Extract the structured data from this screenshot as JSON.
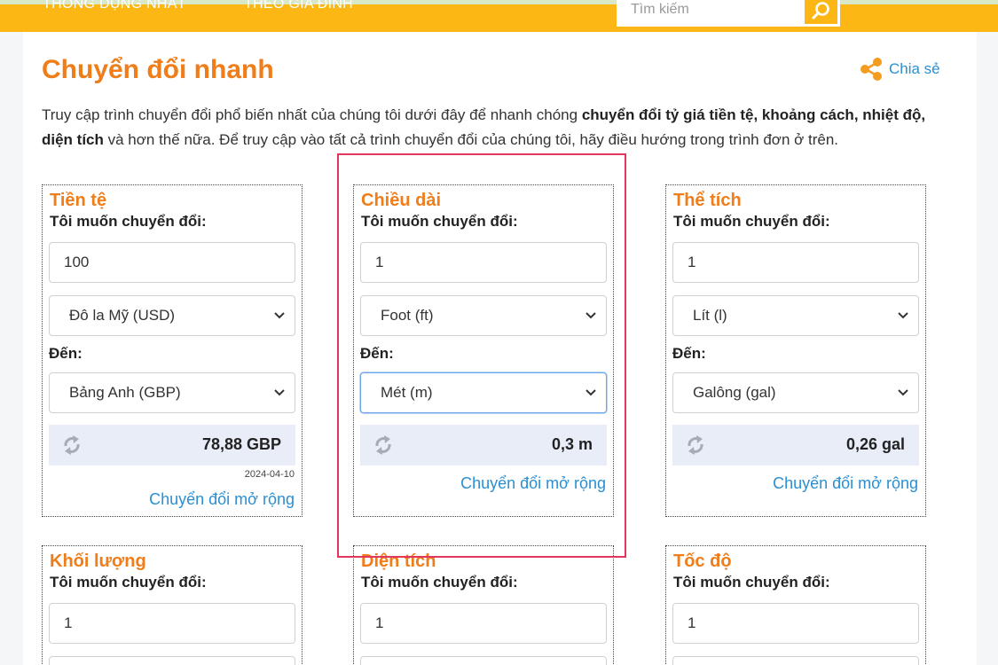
{
  "nav": {
    "items": [
      "THÔNG DỤNG NHẤT",
      "THEO GIA ĐÌNH"
    ],
    "search_placeholder": "Tìm kiếm",
    "search_icon": "search-icon"
  },
  "page": {
    "title": "Chuyển đổi nhanh",
    "share_label": "Chia sẻ",
    "intro_1": "Truy cập trình chuyển đổi phổ biến nhất của chúng tôi dưới đây để nhanh chóng ",
    "intro_bold_1": "chuyển đổi tỷ giá tiền tệ, khoảng cách, nhiệt độ, diện tích",
    "intro_2": " và hơn thế nữa. Để truy cập vào tất cả trình chuyển đổi của chúng tôi, hãy điều hướng trong trình đơn ở trên."
  },
  "converters": [
    {
      "title": "Tiền tệ",
      "subtitle": "Tôi muốn chuyển đổi:",
      "amount": "100",
      "from": "Đô la Mỹ (USD)",
      "to_label": "Đến:",
      "to": "Bảng Anh (GBP)",
      "result": "78,88 GBP",
      "date": "2024-04-10",
      "more": "Chuyển đổi mở rộng"
    },
    {
      "title": "Chiều dài",
      "subtitle": "Tôi muốn chuyển đổi:",
      "amount": "1",
      "from": "Foot (ft)",
      "to_label": "Đến:",
      "to": "Mét (m)",
      "result": "0,3 m",
      "more": "Chuyển đổi mở rộng"
    },
    {
      "title": "Thể tích",
      "subtitle": "Tôi muốn chuyển đổi:",
      "amount": "1",
      "from": "Lít (l)",
      "to_label": "Đến:",
      "to": "Galông (gal)",
      "result": "0,26 gal",
      "more": "Chuyển đổi mở rộng"
    },
    {
      "title": "Khối lượng",
      "subtitle": "Tôi muốn chuyển đổi:",
      "amount": "1"
    },
    {
      "title": "Diện tích",
      "subtitle": "Tôi muốn chuyển đổi:",
      "amount": "1"
    },
    {
      "title": "Tốc độ",
      "subtitle": "Tôi muốn chuyển đổi:",
      "amount": "1"
    }
  ],
  "colors": {
    "accent": "#ef7d1a",
    "topbar": "#fcb714",
    "link": "#2a8fd3",
    "highlight": "#e2375d"
  }
}
